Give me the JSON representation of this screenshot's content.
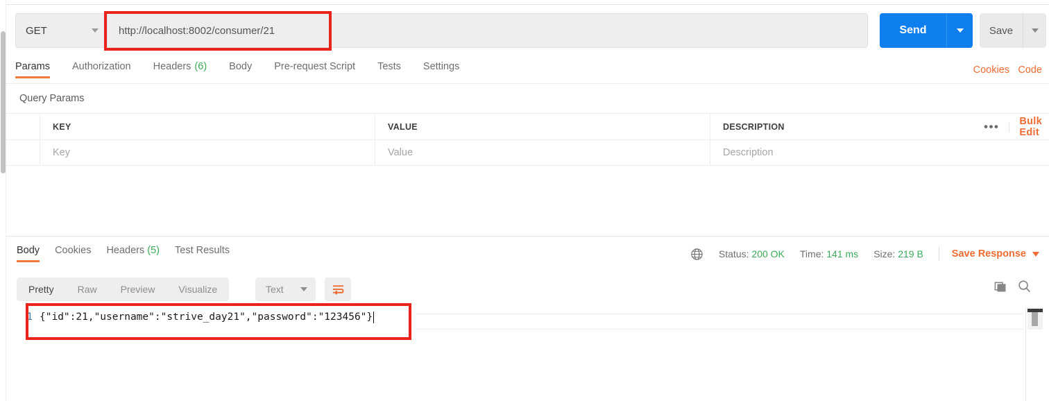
{
  "request": {
    "method": "GET",
    "url": "http://localhost:8002/consumer/21",
    "send_label": "Send",
    "save_label": "Save",
    "tabs": [
      {
        "label": "Params",
        "count": "",
        "active": true
      },
      {
        "label": "Authorization",
        "count": "",
        "active": false
      },
      {
        "label": "Headers",
        "count": "(6)",
        "active": false
      },
      {
        "label": "Body",
        "count": "",
        "active": false
      },
      {
        "label": "Pre-request Script",
        "count": "",
        "active": false
      },
      {
        "label": "Tests",
        "count": "",
        "active": false
      },
      {
        "label": "Settings",
        "count": "",
        "active": false
      }
    ],
    "cookies_link": "Cookies",
    "code_link": "Code"
  },
  "query_params": {
    "title": "Query Params",
    "columns": [
      "KEY",
      "VALUE",
      "DESCRIPTION"
    ],
    "rows": [
      {
        "key": "Key",
        "value": "Value",
        "description": "Description"
      }
    ],
    "more_actions": "•••",
    "bulk_edit": "Bulk Edit"
  },
  "response": {
    "tabs": [
      {
        "label": "Body",
        "count": "",
        "active": true
      },
      {
        "label": "Cookies",
        "count": "",
        "active": false
      },
      {
        "label": "Headers",
        "count": "(5)",
        "active": false
      },
      {
        "label": "Test Results",
        "count": "",
        "active": false
      }
    ],
    "status_label": "Status:",
    "status_value": "200 OK",
    "time_label": "Time:",
    "time_value": "141 ms",
    "size_label": "Size:",
    "size_value": "219 B",
    "save_response": "Save Response",
    "format_tabs": [
      {
        "label": "Pretty",
        "active": true
      },
      {
        "label": "Raw",
        "active": false
      },
      {
        "label": "Preview",
        "active": false
      },
      {
        "label": "Visualize",
        "active": false
      }
    ],
    "language": "Text",
    "body_lines": [
      {
        "number": "1",
        "text": "{\"id\":21,\"username\":\"strive_day21\",\"password\":\"123456\"}"
      }
    ]
  },
  "colors": {
    "accent_orange": "#ef6c33",
    "send_blue": "#0f7ff0",
    "status_green": "#3bab5a",
    "annotation_red": "#e8241b"
  }
}
